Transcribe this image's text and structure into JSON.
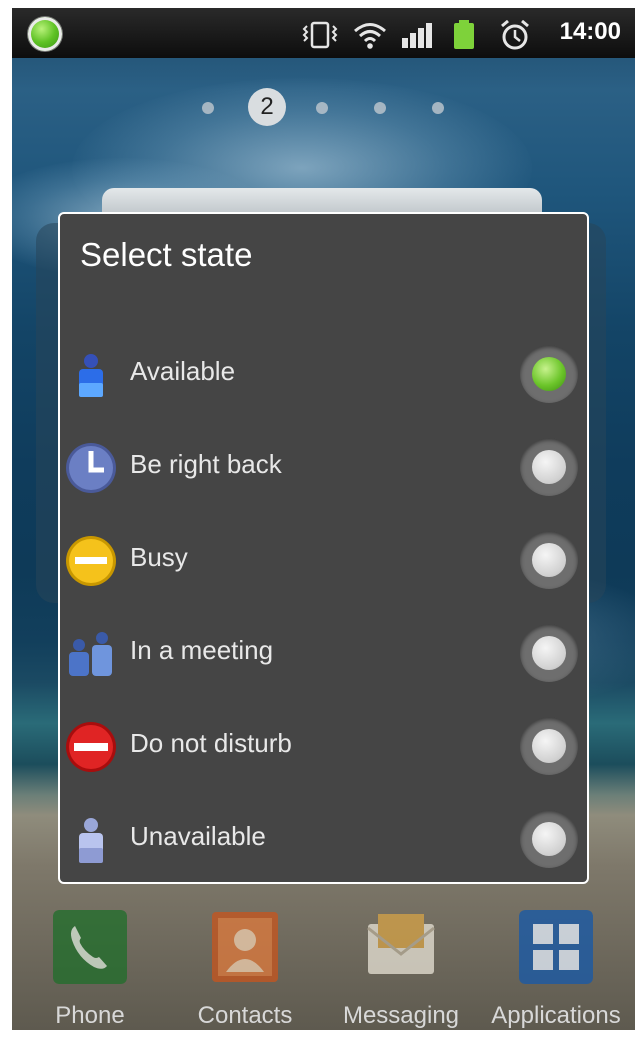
{
  "statusbar": {
    "time": "14:00",
    "icons": [
      "presence-green-icon",
      "vibrate-icon",
      "wifi-icon",
      "signal-icon",
      "battery-icon",
      "alarm-icon"
    ]
  },
  "home": {
    "current_page": "2",
    "page_count": 5
  },
  "dialog": {
    "title": "Select state",
    "options": [
      {
        "label": "Available",
        "icon": "person-blue-icon",
        "selected": true
      },
      {
        "label": "Be right back",
        "icon": "clock-icon",
        "selected": false
      },
      {
        "label": "Busy",
        "icon": "busy-yellow-icon",
        "selected": false
      },
      {
        "label": "In a meeting",
        "icon": "people-meeting-icon",
        "selected": false
      },
      {
        "label": "Do not disturb",
        "icon": "do-not-disturb-red-icon",
        "selected": false
      },
      {
        "label": "Unavailable",
        "icon": "person-pale-icon",
        "selected": false
      }
    ]
  },
  "dock": {
    "items": [
      {
        "label": "Phone",
        "icon": "phone-icon",
        "color": "#1f6e2a"
      },
      {
        "label": "Contacts",
        "icon": "contacts-icon",
        "color": "#c8551d"
      },
      {
        "label": "Messaging",
        "icon": "messaging-icon",
        "color": "#d6a347"
      },
      {
        "label": "Applications",
        "icon": "applications-grid-icon",
        "color": "#1b5aa5"
      }
    ]
  },
  "colors": {
    "dialog_bg": "#454545",
    "selected_radio": "#6cc52a"
  }
}
